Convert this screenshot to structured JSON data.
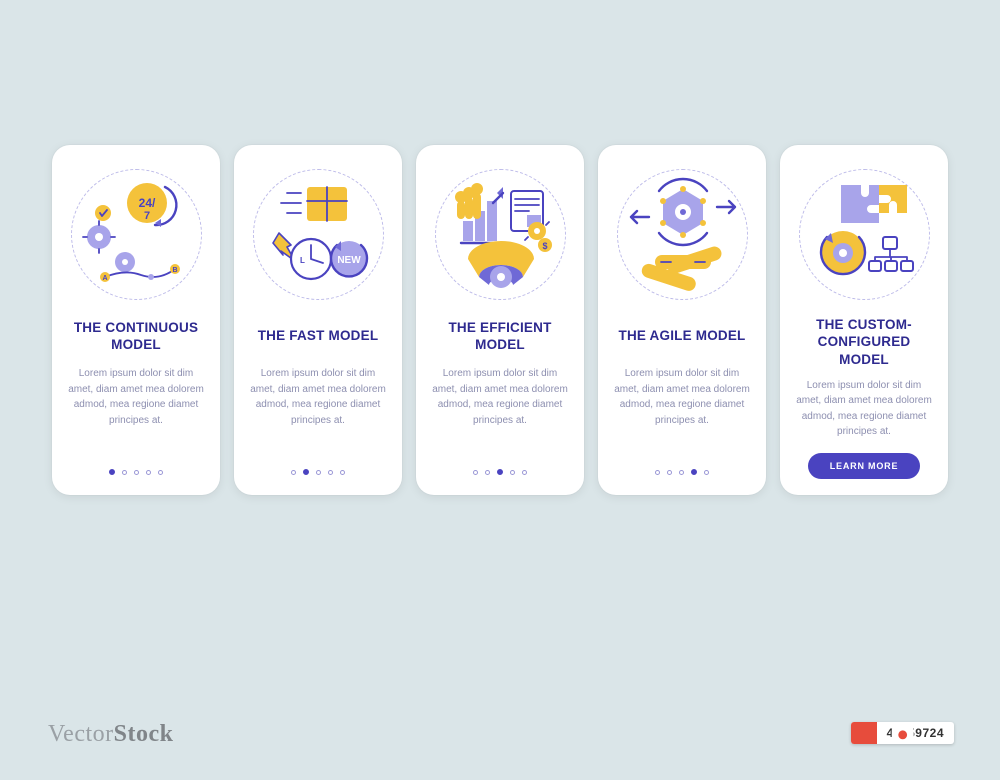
{
  "colors": {
    "accent": "#4a43c0",
    "accent_light": "#a8a4ea",
    "yellow": "#f4c23b",
    "bg": "#dae5e8"
  },
  "cards": [
    {
      "title": "THE CONTINUOUS MODEL",
      "desc": "Lorem ipsum dolor sit dim amet, diam amet mea dolorem admod, mea regione diamet principes at.",
      "active_index": 0,
      "has_cta": false,
      "icon": "continuous"
    },
    {
      "title": "The Fast Model",
      "desc": "Lorem ipsum dolor sit dim amet, diam amet mea dolorem admod, mea regione diamet principes at.",
      "active_index": 1,
      "has_cta": false,
      "icon": "fast"
    },
    {
      "title": "The Efficient Model",
      "desc": "Lorem ipsum dolor sit dim amet, diam amet mea dolorem admod, mea regione diamet principes at.",
      "active_index": 2,
      "has_cta": false,
      "icon": "efficient"
    },
    {
      "title": "The Agile Model",
      "desc": "Lorem ipsum dolor sit dim amet, diam amet mea dolorem admod, mea regione diamet principes at.",
      "active_index": 3,
      "has_cta": false,
      "icon": "agile"
    },
    {
      "title": "THE CUSTOM-CONFIGURED MODEL",
      "desc": "Lorem ipsum dolor sit dim amet, diam amet mea dolorem admod, mea regione diamet principes at.",
      "active_index": 4,
      "has_cta": true,
      "icon": "custom"
    }
  ],
  "dot_count": 5,
  "cta_label": "LEARN MORE",
  "watermark": {
    "left": "Vector",
    "right": "Stock"
  },
  "image_id": "43459724"
}
